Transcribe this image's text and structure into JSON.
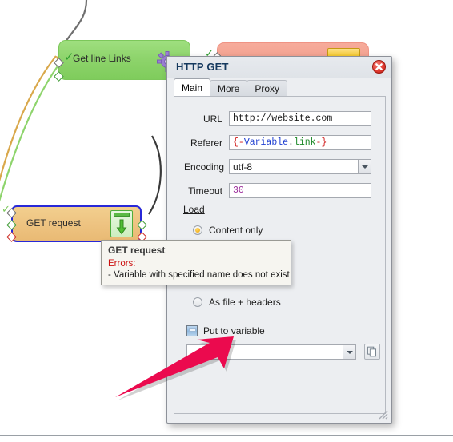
{
  "canvas": {
    "nodes": [
      {
        "id": "get-line-links",
        "label": "Get line Links",
        "color": "#8ed46c",
        "status_icon": "check-icon"
      },
      {
        "id": "hidden-salmon-node",
        "label": "",
        "color": "#f3a08e",
        "status_icon": "gold-rect-icon"
      },
      {
        "id": "get-request",
        "label": "GET request",
        "color": "#eec482",
        "status_icon": "download-icon",
        "selected": true
      }
    ],
    "gear_icon": "gear-icon"
  },
  "tooltip": {
    "title": "GET request",
    "errors_label": "Errors:",
    "error_line": "- Variable with specified name does not exist"
  },
  "dialog": {
    "title": "HTTP GET",
    "close_icon": "close-icon",
    "resize_grip_icon": "resize-grip-icon",
    "tabs": [
      {
        "label": "Main",
        "active": true
      },
      {
        "label": "More",
        "active": false
      },
      {
        "label": "Proxy",
        "active": false
      }
    ],
    "fields": {
      "url": {
        "label": "URL",
        "value": "http://website.com"
      },
      "referer": {
        "label": "Referer",
        "value_parts": [
          {
            "text": "{-",
            "color": "#d11f1f"
          },
          {
            "text": "Variable",
            "color": "#1f3fd1"
          },
          {
            "text": ".",
            "color": "#222222"
          },
          {
            "text": "link",
            "color": "#1f8a2a"
          },
          {
            "text": "-}",
            "color": "#d11f1f"
          }
        ]
      },
      "encoding": {
        "label": "Encoding",
        "value": "utf-8",
        "dropdown_icon": "chevron-down-icon"
      },
      "timeout": {
        "label": "Timeout",
        "value": "30",
        "value_color": "#9b2d9b"
      }
    },
    "load_section": {
      "label": "Load",
      "options": [
        {
          "label": "Content only",
          "selected": true
        },
        {
          "label": "As file + headers",
          "selected": false
        }
      ]
    },
    "put_to_variable": {
      "label": "Put to variable",
      "checked": true,
      "input_value": "",
      "dropdown_icon": "chevron-down-icon",
      "copy_icon": "copy-pages-icon"
    }
  },
  "annotation": {
    "arrow_color": "#eb0a4e",
    "arrow_icon": "pointer-arrow-icon"
  }
}
